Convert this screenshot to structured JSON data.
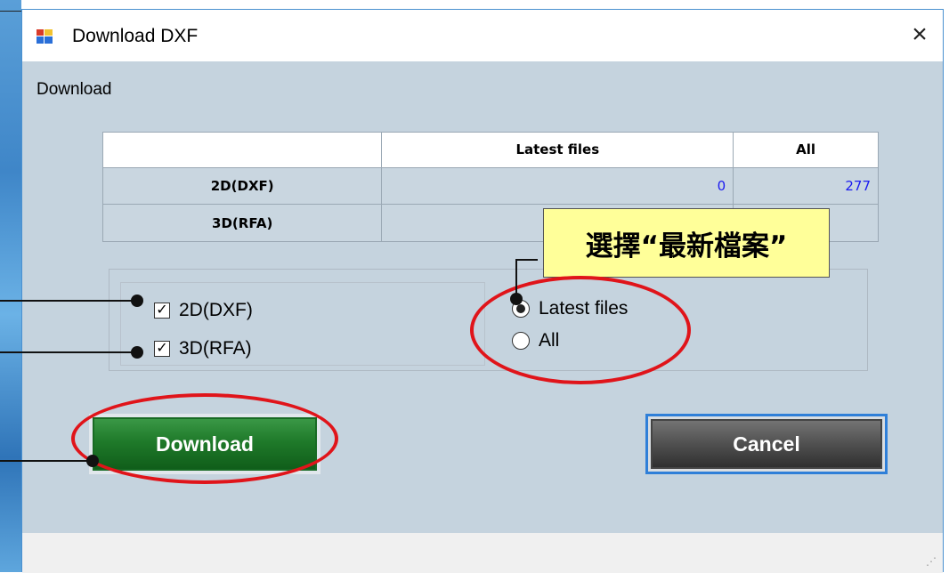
{
  "window": {
    "title": "Download DXF",
    "close_glyph": "×"
  },
  "section_label": "Download",
  "table": {
    "headers": [
      "",
      "Latest files",
      "All"
    ],
    "rows": [
      {
        "label": "2D(DXF)",
        "latest": "0",
        "all": "277"
      },
      {
        "label": "3D(RFA)",
        "latest": "",
        "all": ""
      }
    ]
  },
  "checkboxes": [
    {
      "label": "2D(DXF)",
      "checked": true,
      "mark": "✓"
    },
    {
      "label": "3D(RFA)",
      "checked": true,
      "mark": "✓"
    }
  ],
  "radios": [
    {
      "label": "Latest files",
      "selected": true
    },
    {
      "label": "All",
      "selected": false
    }
  ],
  "buttons": {
    "download": "Download",
    "cancel": "Cancel"
  },
  "annotation": {
    "callout_text": "選擇“最新檔案”",
    "highlight_color": "#e0141a",
    "callout_color": "#ffff99"
  },
  "icons": [
    "app-icon",
    "close-icon",
    "checkbox-check-icon",
    "radio-dot-icon",
    "resize-grip-icon"
  ],
  "colors": {
    "client_bg": "#c5d3de",
    "download_button": "#1f7a2a",
    "cancel_button": "#505050",
    "focus_border": "#2f7fd8",
    "table_number": "#1a1af0"
  }
}
